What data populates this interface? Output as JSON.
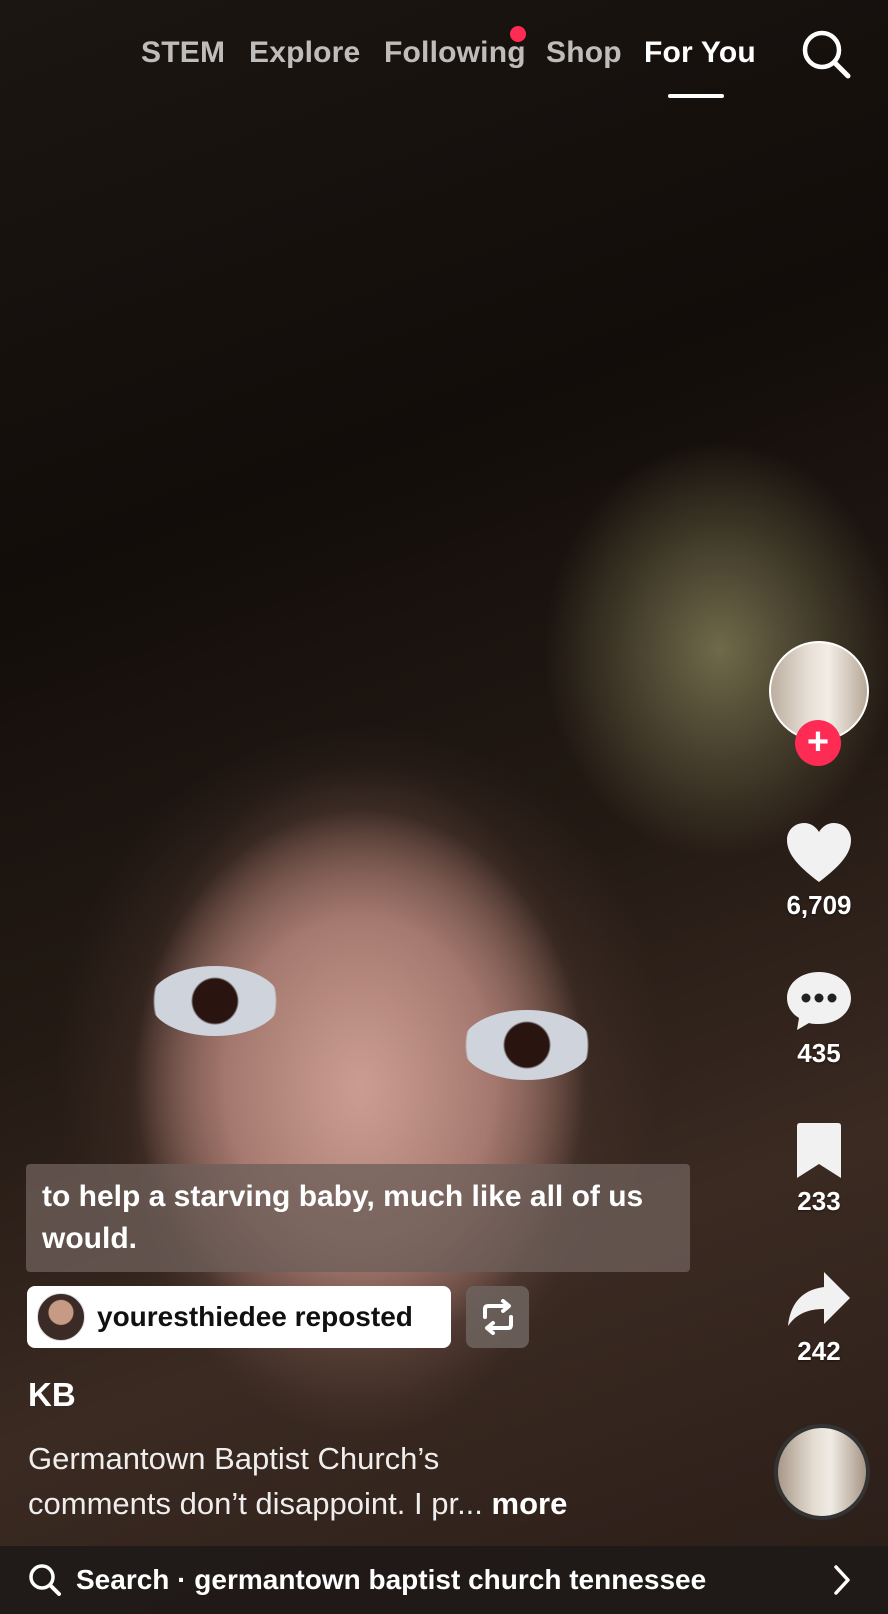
{
  "topnav": {
    "tabs": [
      {
        "label": "STEM"
      },
      {
        "label": "Explore"
      },
      {
        "label": "Following"
      },
      {
        "label": "Shop"
      },
      {
        "label": "For You"
      }
    ],
    "active_tab": "For You"
  },
  "rail": {
    "likes": "6,709",
    "comments": "435",
    "saves": "233",
    "shares": "242"
  },
  "caption_overlay": "to help a starving baby, much like all of us would.",
  "repost": {
    "text": "youresthiedee reposted"
  },
  "author": "KB",
  "description": {
    "line1": "Germantown Baptist Church’s",
    "line2": "comments don’t disappoint. I pr...",
    "more": "more"
  },
  "search_bar": {
    "text": "Search · germantown baptist church tennessee"
  },
  "colors": {
    "accent": "#fe2c55",
    "text": "#ffffff"
  }
}
